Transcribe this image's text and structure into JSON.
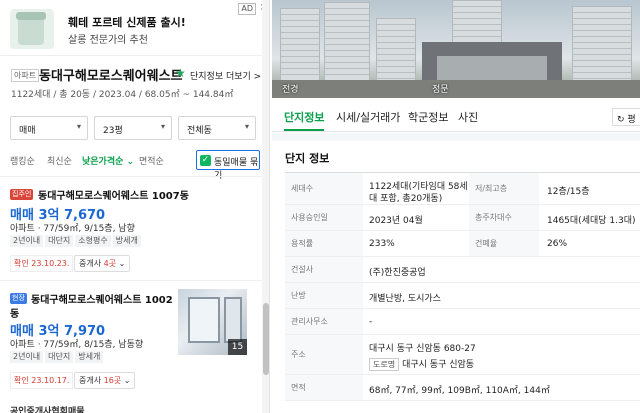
{
  "ad": {
    "title": "훼테 포르테 신제품 출시!",
    "subtitle": "살롱 전문가의 추천",
    "badge": "AD",
    "close": "×"
  },
  "complex": {
    "type_badge": "아파트",
    "name": "동대구해모로스퀘어웨스트",
    "favorite_icon": "star-icon",
    "info_link": "단지정보 더보기 >",
    "meta": "1122세대 / 총 20동 / 2023.04 / 68.05㎡ ~ 144.84㎡"
  },
  "filters": [
    {
      "value": "매매"
    },
    {
      "value": "23평"
    },
    {
      "value": "전체동"
    }
  ],
  "sort": {
    "options": [
      "랭킹순",
      "최신순",
      "낮은가격순 ⌄",
      "면적순"
    ],
    "active_index": 2,
    "own_listing_label": "동일매물 묶기"
  },
  "listings": [
    {
      "tag": "집주인",
      "title": "동대구해모로스퀘어웨스트 1007동",
      "price": "매매 3억 7,670",
      "desc": "아파트 · 77/59㎡, 9/15층, 남향",
      "chips": [
        "2년이내",
        "대단지",
        "소형평수",
        "방세개"
      ],
      "confirm": "확인 23.10.23.",
      "agent_label": "중개사",
      "agent_count": "4곳"
    },
    {
      "tag": "현장",
      "title_line1": "동대구해모로스퀘어웨스트 1002",
      "title_line2": "동",
      "price": "매매 3억 7,970",
      "desc": "아파트 · 77/59㎡, 8/15층, 남동향",
      "chips": [
        "2년이내",
        "대단지",
        "방세개"
      ],
      "confirm": "확인 23.10.17.",
      "agent_label": "중개사",
      "agent_count": "16곳",
      "photo_count": "15"
    }
  ],
  "bottom_cut_text": "공인중개사협회매물",
  "hero": {
    "left_label": "전경",
    "right_label": "정문"
  },
  "tabs": [
    "단지정보",
    "시세/실거래가",
    "학군정보",
    "사진"
  ],
  "active_tab": 0,
  "refresh_label": "↻ 평",
  "section_title": "단지 정보",
  "info_rows": [
    {
      "k1": "세대수",
      "v1_line1": "1122세대(기타임대 58세",
      "v1_line2": "대 포함, 총20개동)",
      "k2": "저/최고층",
      "v2": "12층/15층"
    },
    {
      "k1": "사용승인일",
      "v1": "2023년 04월",
      "k2": "총주차대수",
      "v2": "1465대(세대당 1.3대)"
    },
    {
      "k1": "용적률",
      "v1": "233%",
      "k2": "건폐율",
      "v2": "26%"
    },
    {
      "k1": "건설사",
      "v1": "(주)한진중공업"
    },
    {
      "k1": "난방",
      "v1": "개별난방, 도시가스"
    },
    {
      "k1": "관리사무소",
      "v1": "-"
    },
    {
      "k1": "주소",
      "v1": "대구시 동구 신암동 680-27",
      "road_tag": "도로명",
      "v1_road": "대구시 동구 신암동"
    },
    {
      "k1": "면적",
      "v1": "68㎡, 77㎡, 99㎡, 109B㎡, 110A㎡, 144㎡"
    }
  ]
}
